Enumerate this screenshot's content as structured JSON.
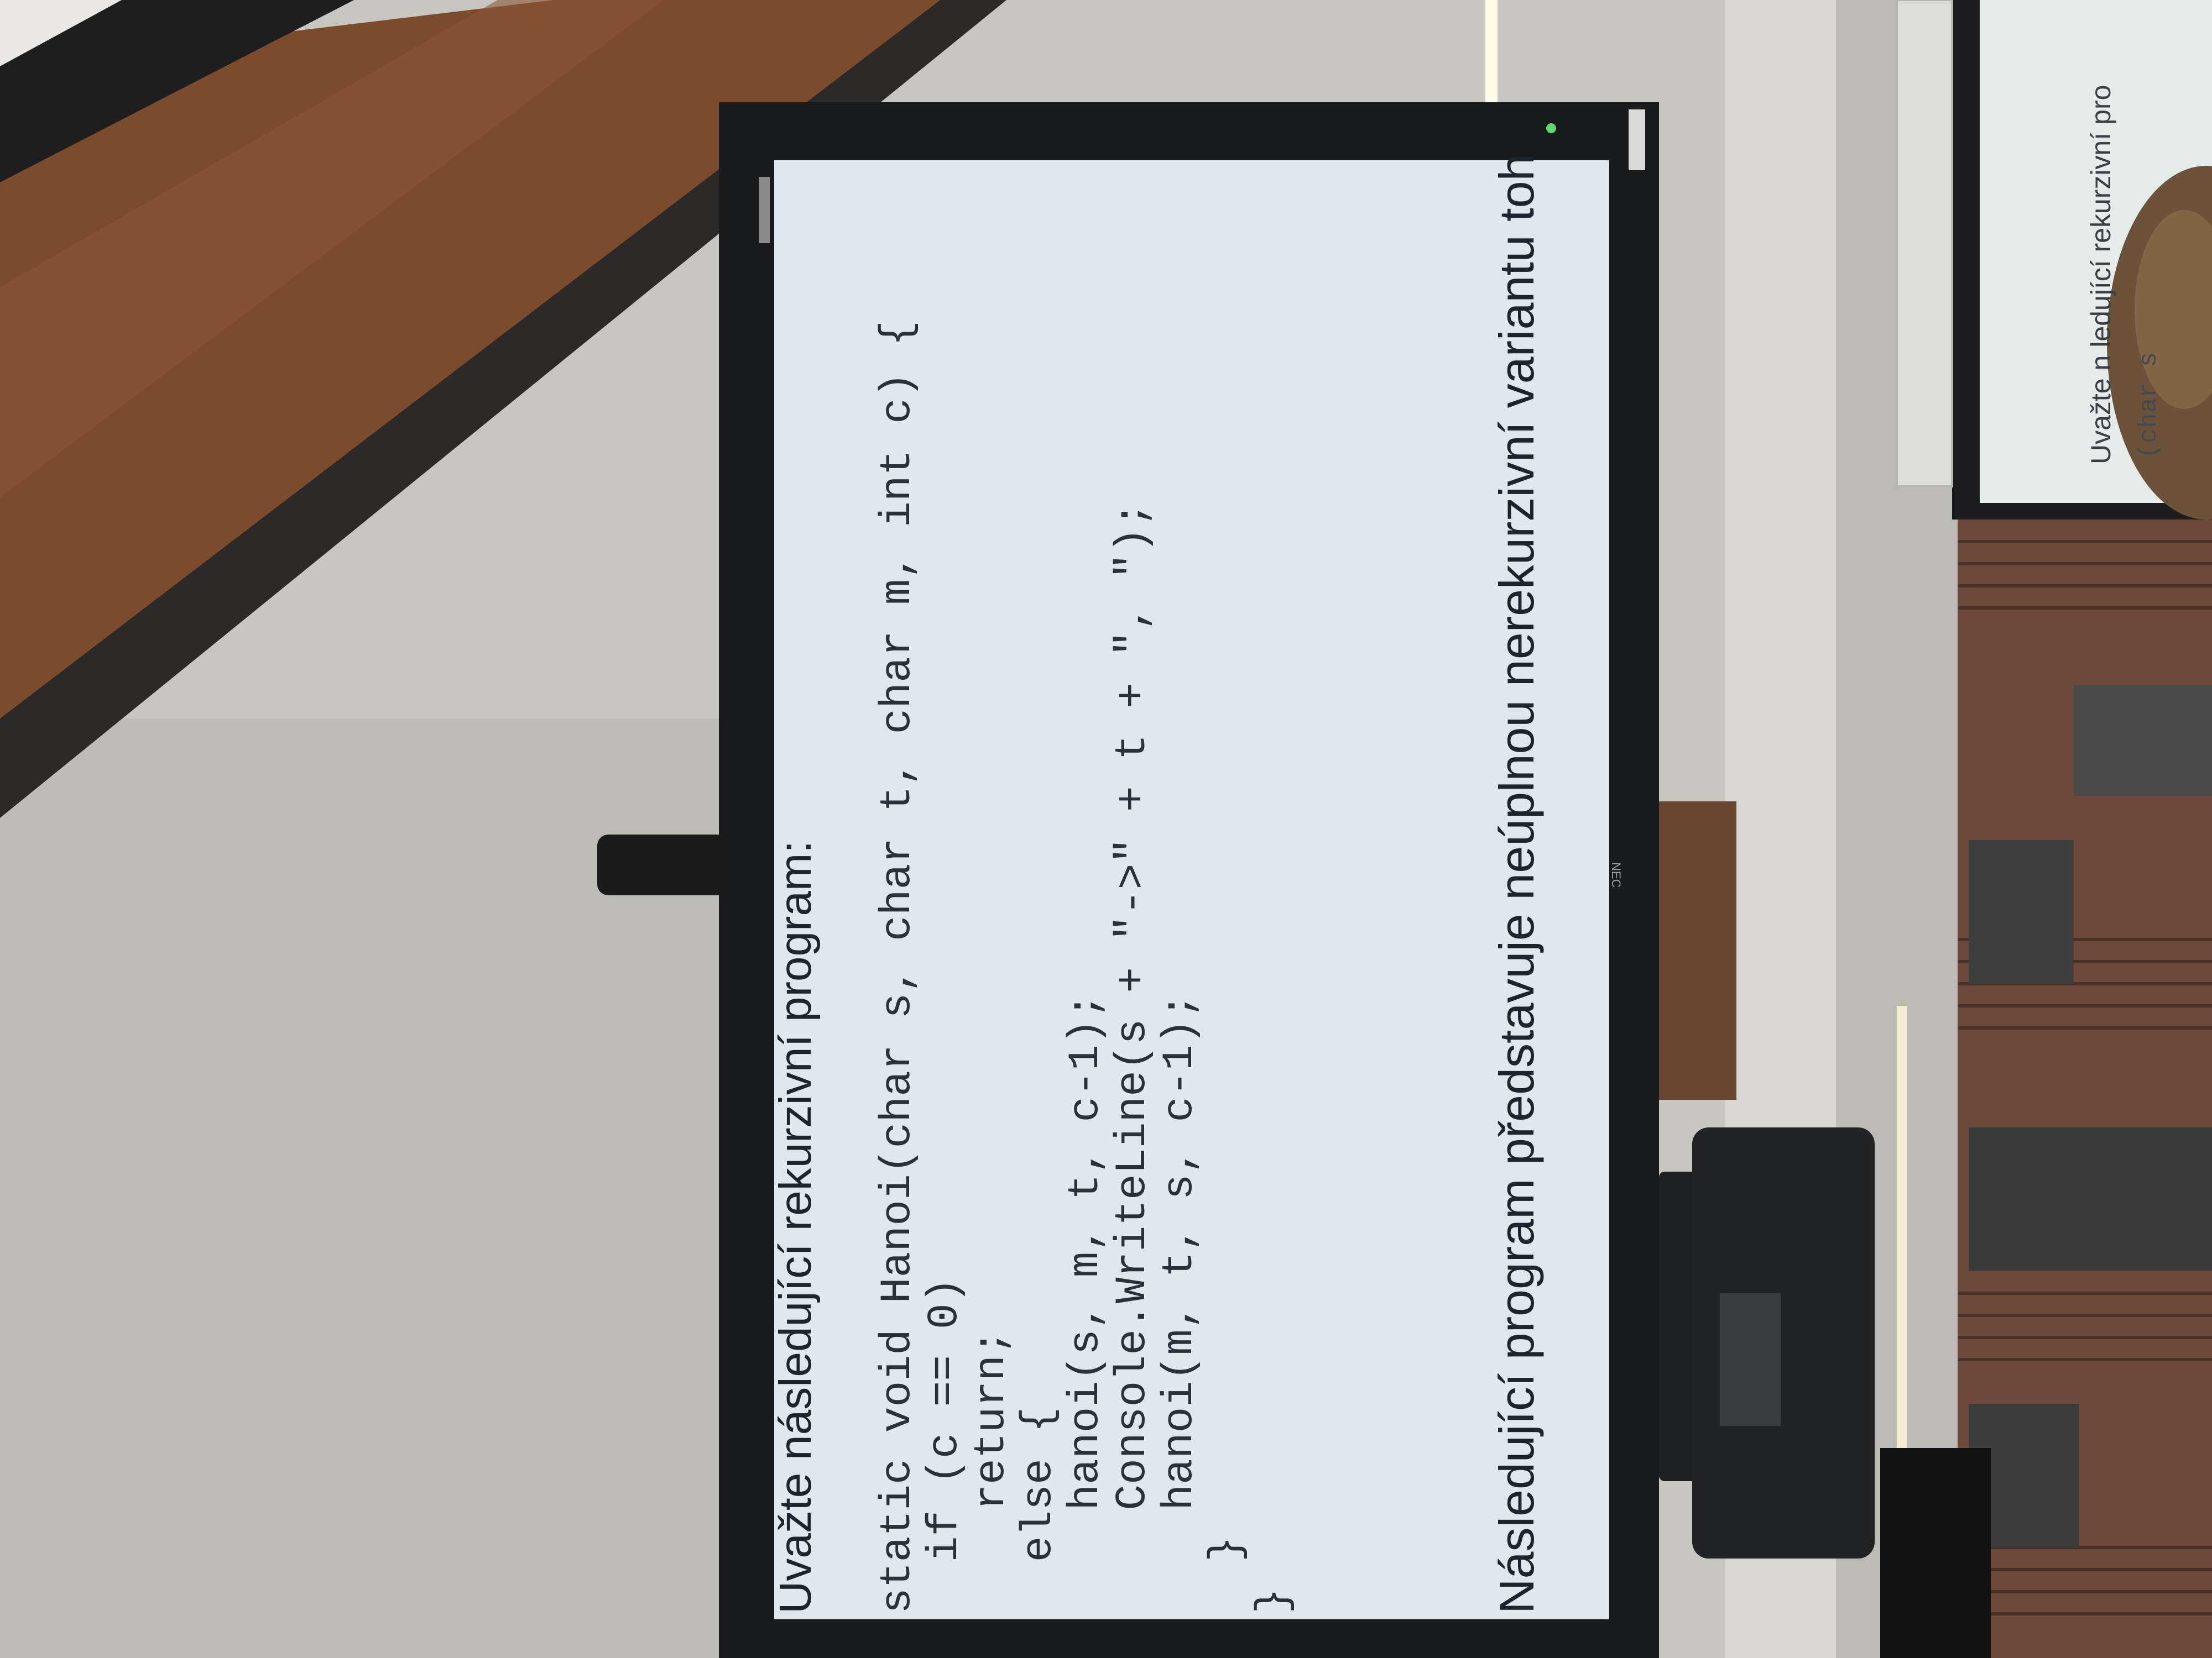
{
  "slide": {
    "heading": "Uvažte následující rekurzivní program:",
    "code_lines": [
      "static void Hanoi(char s, char t, char m, int c) {",
      "  if (c == 0)",
      "    return;",
      "  else {",
      "    hanoi(s, m, t, c-1);",
      "    Console.WriteLine(s + \"->\" + t + \", \");",
      "    hanoi(m, t, s, c-1);",
      "  }",
      "}"
    ],
    "footer": "Následující program představuje neúplnou nerekurzivní variantu toh"
  },
  "monitor": {
    "brand": "NEC"
  },
  "second_screen": {
    "line": "Uvažte n    ledující rekurzivní pro",
    "code_fragment": "(char s"
  },
  "colors": {
    "slide_bg": "#dfe9f0",
    "wall": "#c9c8c3",
    "wood_beam": "#7a4a2c",
    "bezel": "#1b1c1e"
  }
}
